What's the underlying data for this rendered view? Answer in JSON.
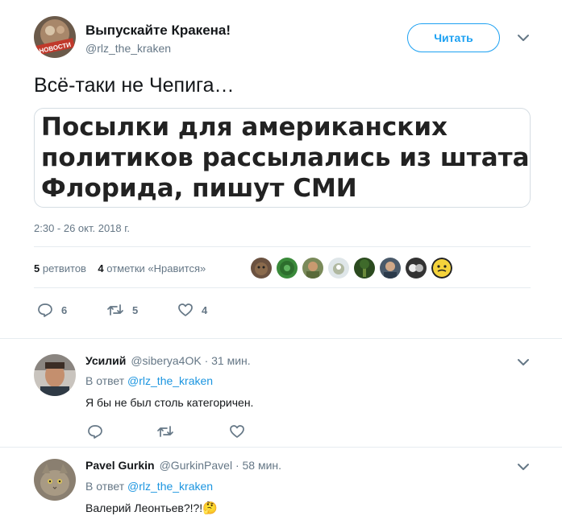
{
  "tweet": {
    "display_name": "Выпускайте Кракена!",
    "screen_name": "@rlz_the_kraken",
    "follow_label": "Читать",
    "text": "Всё-таки не Чепига…",
    "avatar_label": "НОВОСТИ",
    "card_lines": [
      "Посылки для американских",
      "политиков рассылались из штата",
      "Флорида, пишут СМИ"
    ],
    "timestamp": "2:30 - 26 окт. 2018 г.",
    "stats": {
      "retweets_count": "5",
      "retweets_label": "ретвитов",
      "likes_count": "4",
      "likes_label": "отметки «Нравится»"
    },
    "actions": {
      "replies": "6",
      "retweets": "5",
      "likes": "4"
    }
  },
  "replies": [
    {
      "name": "Усилий",
      "handle": "@siberya4OK · 31 мин.",
      "in_reply_prefix": "В ответ",
      "in_reply_to": "@rlz_the_kraken",
      "text": "Я бы не был столь категоричен."
    },
    {
      "name": "Pavel Gurkin",
      "handle": "@GurkinPavel · 58 мин.",
      "in_reply_prefix": "В ответ",
      "in_reply_to": "@rlz_the_kraken",
      "text": "Валерий Леонтьев?!?!",
      "emoji": "🤔"
    }
  ],
  "colors": {
    "accent": "#1da1f2",
    "secondary_text": "#657786",
    "divider": "#e6ecf0"
  }
}
